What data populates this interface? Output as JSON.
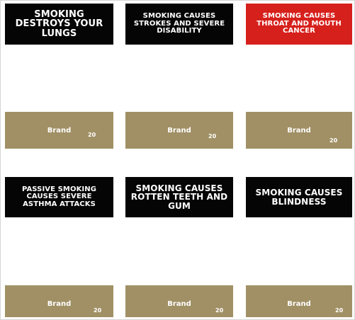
{
  "panels": [
    {
      "warning": "SMOKING DESTROYS YOUR LUNGS",
      "brand": "Brand",
      "count": "20"
    },
    {
      "warning": "SMOKING CAUSES STROKES AND SEVERE DISABILITY",
      "brand": "Brand",
      "count": "20"
    },
    {
      "warning": "SMOKING CAUSES THROAT AND MOUTH CANCER",
      "brand": "Brand",
      "count": "20",
      "warning_color": "#d6201c"
    },
    {
      "warning": "PASSIVE SMOKING CAUSES SEVERE ASTHMA ATTACKS",
      "brand": "Brand",
      "count": "20"
    },
    {
      "warning": "SMOKING CAUSES ROTTEN TEETH AND GUM",
      "brand": "Brand",
      "count": "20"
    },
    {
      "warning": "SMOKING CAUSES BLINDNESS",
      "brand": "Brand",
      "count": "20"
    }
  ],
  "colors": {
    "warning_background": "#050505",
    "pack_background": "#a19065",
    "text": "#ffffff"
  }
}
